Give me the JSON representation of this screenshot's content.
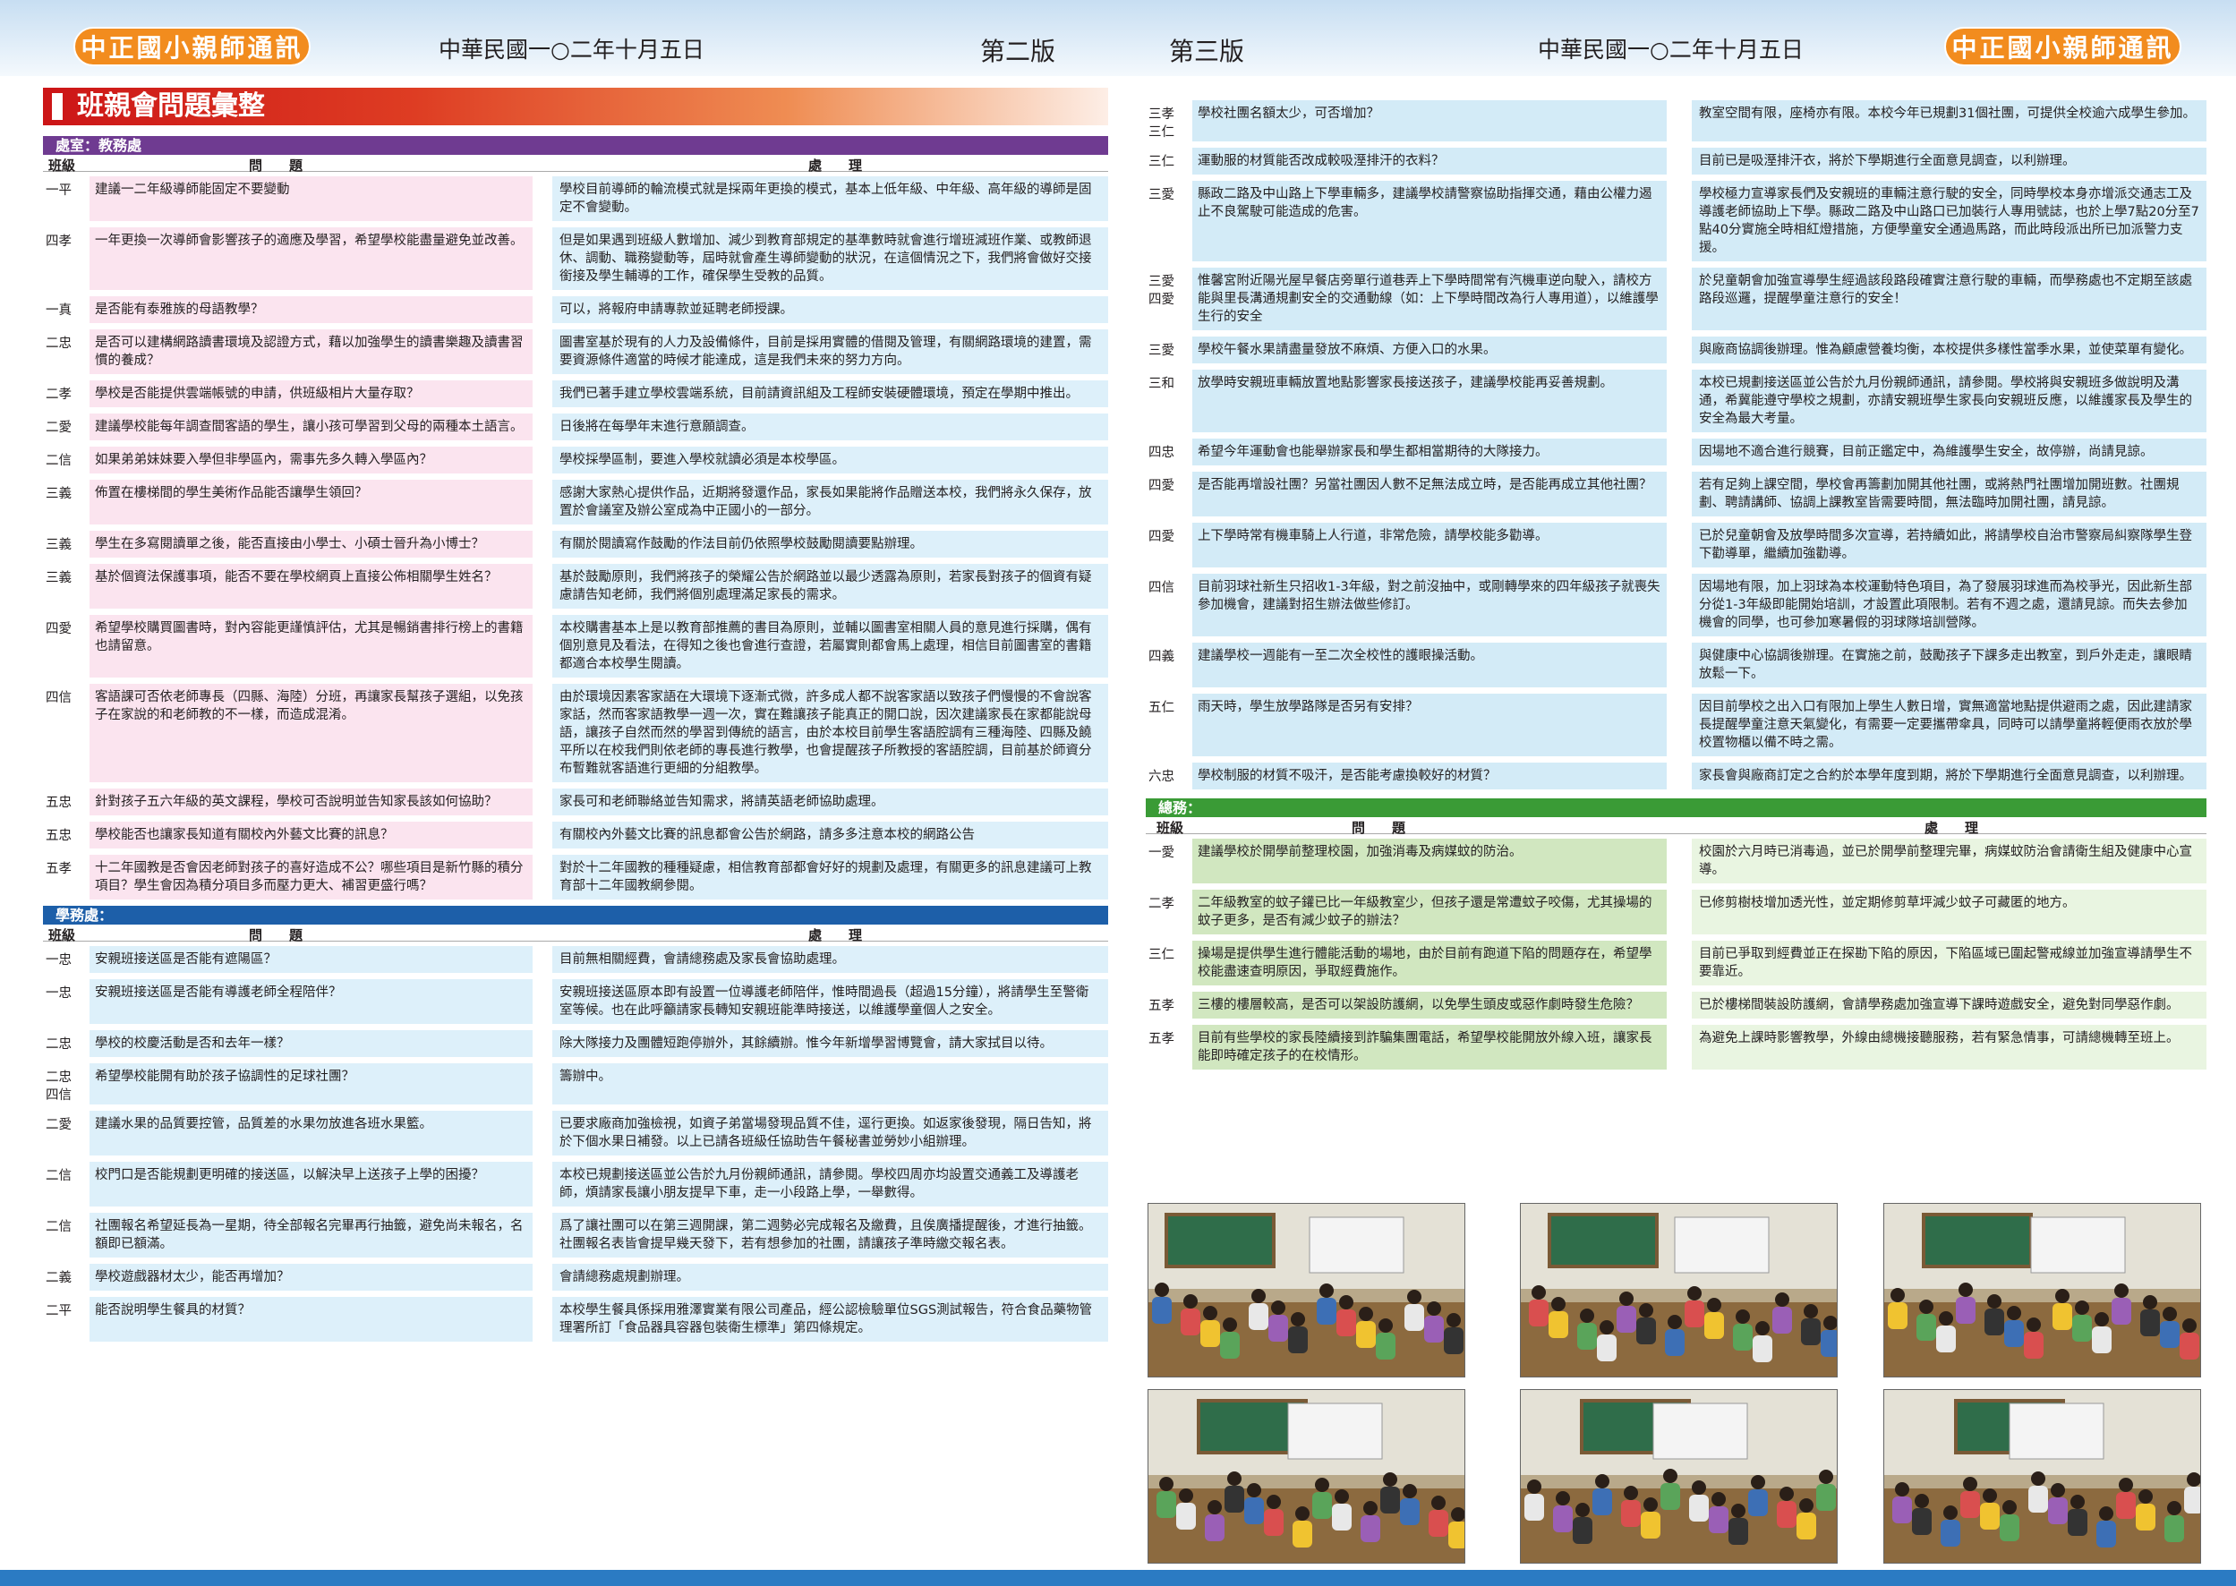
{
  "header": {
    "newsletter_name": "中正國小親師通訊",
    "date": "中華民國一○二年十月五日",
    "left_edition": "第二版",
    "right_edition": "第三版"
  },
  "section_title": "班親會問題彙整",
  "labels": {
    "class": "班級",
    "question": "問　　題",
    "answer": "處　　理"
  },
  "colors": {
    "academic": "#6f3b91",
    "student": "#1d5fa9",
    "general": "#3a9b36",
    "orange": "#f28c1e"
  },
  "academic": {
    "dept": "處室：教務處",
    "rows": [
      {
        "cls": "一平",
        "q": "建議一二年級導師能固定不要變動",
        "a": "學校目前導師的輪流模式就是採兩年更換的模式，基本上低年級、中年級、高年級的導師是固定不會變動。"
      },
      {
        "cls": "四孝",
        "q": "一年更換一次導師會影響孩子的適應及學習，希望學校能盡量避免並改善。",
        "a": "但是如果遇到班級人數增加、減少到教育部規定的基準數時就會進行增班減班作業、或教師退休、調動、職務變動等，屆時就會產生導師變動的狀況，在這個情況之下，我們將會做好交接銜接及學生輔導的工作，確保學生受教的品質。"
      },
      {
        "cls": "一真",
        "q": "是否能有泰雅族的母語教學？",
        "a": "可以，將報府申請專款並延聘老師授課。"
      },
      {
        "cls": "二忠",
        "q": "是否可以建構網路讀書環境及認證方式，藉以加強學生的讀書樂趣及讀書習慣的養成？",
        "a": "圖書室基於現有的人力及設備條件，目前是採用實體的借閱及管理，有關網路環境的建置，需要資源條件適當的時候才能達成，這是我們未來的努力方向。"
      },
      {
        "cls": "二孝",
        "q": "學校是否能提供雲端帳號的申請，供班級相片大量存取？",
        "a": "我們已著手建立學校雲端系統，目前請資訊組及工程師安裝硬體環境，預定在學期中推出。"
      },
      {
        "cls": "二愛",
        "q": "建議學校能每年調查間客語的學生，讓小孩可學習到父母的兩種本土語言。",
        "a": "日後將在每學年末進行意願調查。"
      },
      {
        "cls": "二信",
        "q": "如果弟弟妹妹要入學但非學區內，需事先多久轉入學區內？",
        "a": "學校採學區制，要進入學校就讀必須是本校學區。"
      },
      {
        "cls": "三義",
        "q": "佈置在樓梯間的學生美術作品能否讓學生領回？",
        "a": "感謝大家熱心提供作品，近期將發還作品，家長如果能將作品贈送本校，我們將永久保存，放置於會議室及辦公室成為中正國小的一部分。"
      },
      {
        "cls": "三義",
        "q": "學生在多寫閱讀單之後，能否直接由小學士、小碩士晉升為小博士？",
        "a": "有關於閱讀寫作鼓勵的作法目前仍依照學校鼓勵閱讀要點辦理。"
      },
      {
        "cls": "三義",
        "q": "基於個資法保護事項，能否不要在學校網頁上直接公佈相關學生姓名？",
        "a": "基於鼓勵原則，我們將孩子的榮耀公告於網路並以最少透露為原則，若家長對孩子的個資有疑慮請告知老師，我們將個別處理滿足家長的需求。"
      },
      {
        "cls": "四愛",
        "q": "希望學校購買圖書時，對內容能更謹慎評估，尤其是暢銷書排行榜上的書籍也請留意。",
        "a": "本校購書基本上是以教育部推薦的書目為原則，並輔以圖書室相關人員的意見進行採購，偶有個別意見及看法，在得知之後也會進行查證，若屬實則都會馬上處理，相信目前圖書室的書籍都適合本校學生閱讀。"
      },
      {
        "cls": "四信",
        "q": "客語課可否依老師專長（四縣、海陸）分班，再讓家長幫孩子選組，以免孩子在家說的和老師教的不一樣，而造成混淆。",
        "a": "由於環境因素客家語在大環境下逐漸式微，許多成人都不說客家語以致孩子們慢慢的不會說客家話，然而客家語教學一週一次，實在難讓孩子能真正的開口說，因次建議家長在家都能說母語，讓孩子自然而然的學習到傳統的語言，由於本校目前學生客語腔調有三種海陸、四縣及饒平所以在校我們則依老師的專長進行教學，也會提醒孩子所教授的客語腔調，目前基於師資分布暫難就客語進行更細的分組教學。"
      },
      {
        "cls": "五忠",
        "q": "針對孩子五六年級的英文課程，學校可否說明並告知家長該如何協助？",
        "a": "家長可和老師聯絡並告知需求，將請英語老師協助處理。"
      },
      {
        "cls": "五忠",
        "q": "學校能否也讓家長知道有關校內外藝文比賽的訊息？",
        "a": "有關校內外藝文比賽的訊息都會公告於網路，請多多注意本校的網路公告"
      },
      {
        "cls": "五孝",
        "q": "十二年國教是否會因老師對孩子的喜好造成不公？哪些項目是新竹縣的積分項目？學生會因為積分項目多而壓力更大、補習更盛行嗎？",
        "a": "對於十二年國教的種種疑慮，相信教育部都會好好的規劃及處理，有關更多的訊息建議可上教育部十二年國教網參閱。"
      }
    ]
  },
  "student": {
    "dept": "學務處：",
    "rows": [
      {
        "cls": "一忠",
        "q": "安親班接送區是否能有遮陽區？",
        "a": "目前無相關經費，會請總務處及家長會協助處理。"
      },
      {
        "cls": "一忠",
        "q": "安親班接送區是否能有導護老師全程陪伴？",
        "a": "安親班接送區原本即有設置一位導護老師陪伴，惟時間過長（超過15分鐘），將請學生至警衛室等候。也在此呼籲請家長轉知安親班能準時接送，以維護學童個人之安全。"
      },
      {
        "cls": "二忠",
        "q": "學校的校慶活動是否和去年一樣？",
        "a": "除大隊接力及團體短跑停辦外，其餘續辦。惟今年新增學習博覽會，請大家拭目以待。"
      },
      {
        "cls": "二忠\n四信",
        "q": "希望學校能開有助於孩子協調性的足球社團？",
        "a": "籌辦中。"
      },
      {
        "cls": "二愛",
        "q": "建議水果的品質要控管，品質差的水果勿放進各班水果籃。",
        "a": "已要求廠商加強檢視，如資子弟當場發現品質不佳，逕行更換。如返家後發現，隔日告知，將於下個水果日補發。以上已請各班級任協助告午餐秘書並勞妙小組辦理。"
      },
      {
        "cls": "二信",
        "q": "校門口是否能規劃更明確的接送區，以解決早上送孩子上學的困擾？",
        "a": "本校已規劃接送區並公告於九月份親師通訊，請參閱。學校四周亦均設置交通義工及導護老師，煩請家長讓小朋友提早下車，走一小段路上學，一舉數得。"
      },
      {
        "cls": "二信",
        "q": "社團報名希望延長為一星期，待全部報名完畢再行抽籤，避免尚未報名，名額即已額滿。",
        "a": "爲了讓社團可以在第三週開課，第二週勢必完成報名及繳費，且俟廣播提醒後，才進行抽籤。社團報名表皆會提早幾天發下，若有想參加的社團，請讓孩子準時繳交報名表。"
      },
      {
        "cls": "二義",
        "q": "學校遊戲器材太少，能否再增加？",
        "a": "會請總務處規劃辦理。"
      },
      {
        "cls": "二平",
        "q": "能否說明學生餐具的材質？",
        "a": "本校學生餐具係採用雅澤實業有限公司產品，經公認檢驗單位SGS測試報告，符合食品藥物管理署所訂「食品器具容器包裝衛生標準」第四條規定。"
      }
    ]
  },
  "right_rows": [
    {
      "cls": "三孝\n三仁",
      "q": "學校社團名額太少，可否增加？",
      "a": "教室空間有限，座椅亦有限。本校今年已規劃31個社團，可提供全校逾六成學生參加。"
    },
    {
      "cls": "三仁",
      "q": "運動服的材質能否改成較吸溼排汗的衣料？",
      "a": "目前已是吸溼排汗衣，將於下學期進行全面意見調查，以利辦理。"
    },
    {
      "cls": "三愛",
      "q": "縣政二路及中山路上下學車輛多，建議學校請警察協助指揮交通，藉由公權力遏止不良駕駛可能造成的危害。",
      "a": "學校極力宣導家長們及安親班的車輛注意行駛的安全，同時學校本身亦增派交通志工及導護老師協助上下學。縣政二路及中山路口已加裝行人專用號誌，也於上學7點20分至7點40分實施全時相紅燈措施，方便學童安全通過馬路，而此時段派出所已加派警力支援。"
    },
    {
      "cls": "三愛\n四愛",
      "q": "惟馨宮附近陽光屋早餐店旁單行道巷弄上下學時間常有汽機車逆向駛入，請校方能與里長溝通規劃安全的交通動線（如：上下學時間改為行人專用道），以維護學生行的安全",
      "a": "於兒童朝會加強宣導學生經過該段路段確實注意行駛的車輛，而學務處也不定期至該處路段巡邏，提醒學童注意行的安全！"
    },
    {
      "cls": "三愛",
      "q": "學校午餐水果請盡量發放不麻煩、方便入口的水果。",
      "a": "與廠商協調後辦理。惟為顧慮營養均衡，本校提供多樣性當季水果，並使菜單有變化。"
    },
    {
      "cls": "三和",
      "q": "放學時安親班車輛放置地點影響家長接送孩子，建議學校能再妥善規劃。",
      "a": "本校已規劃接送區並公告於九月份親師通訊，請參閱。學校將與安親班多做說明及溝通，希冀能遵守學校之規劃，亦請安親班學生家長向安親班反應，以維護家長及學生的安全為最大考量。"
    },
    {
      "cls": "四忠",
      "q": "希望今年運動會也能舉辦家長和學生都相當期待的大隊接力。",
      "a": "因場地不適合進行競賽，目前正鑑定中，為維護學生安全，故停辦，尚請見諒。"
    },
    {
      "cls": "四愛",
      "q": "是否能再增設社團？另當社團因人數不足無法成立時，是否能再成立其他社團？",
      "a": "若有足夠上課空間，學校會再籌劃加開其他社團，或將熱門社團增加開班數。社團規劃、聘請講師、協調上課教室皆需要時間，無法臨時加開社團，請見諒。"
    },
    {
      "cls": "四愛",
      "q": "上下學時常有機車騎上人行道，非常危險，請學校能多勸導。",
      "a": "已於兒童朝會及放學時間多次宣導，若持續如此，將請學校自治市警察局糾察隊學生登下勸導單，繼續加強勸導。"
    },
    {
      "cls": "四信",
      "q": "目前羽球社新生只招收1-3年級，對之前沒抽中，或剛轉學來的四年級孩子就喪失參加機會，建議對招生辦法做些修訂。",
      "a": "因場地有限，加上羽球為本校運動特色項目，為了發展羽球進而為校爭光，因此新生部分從1-3年級即能開始培訓，才設置此項限制。若有不週之處，還請見諒。而失去參加機會的同學，也可參加寒暑假的羽球隊培訓營隊。"
    },
    {
      "cls": "四義",
      "q": "建議學校一週能有一至二次全校性的護眼操活動。",
      "a": "與健康中心協調後辦理。在實施之前，鼓勵孩子下課多走出教室，到戶外走走，讓眼睛放鬆一下。"
    },
    {
      "cls": "五仁",
      "q": "雨天時，學生放學路隊是否另有安排？",
      "a": "因目前學校之出入口有限加上學生人數日增，實無適當地點提供避雨之處，因此建請家長提醒學童注意天氣變化，有需要一定要攜帶傘具，同時可以請學童將輕便雨衣放於學校置物櫃以備不時之需。"
    },
    {
      "cls": "六忠",
      "q": "學校制服的材質不吸汗，是否能考慮換較好的材質？",
      "a": "家長會與廠商訂定之合約於本學年度到期，將於下學期進行全面意見調查，以利辦理。"
    }
  ],
  "general": {
    "dept": "總務：",
    "rows": [
      {
        "cls": "一愛",
        "q": "建議學校於開學前整理校園，加強消毒及病媒蚊的防治。",
        "a": "校園於六月時已消毒過，並已於開學前整理完畢，病媒蚊防治會請衛生組及健康中心宣導。"
      },
      {
        "cls": "二孝",
        "q": "二年級教室的蚊子鑵已比一年級教室少，但孩子還是常遭蚊子咬傷，尤其操場的蚊子更多，是否有減少蚊子的辦法？",
        "a": "已修剪樹枝增加透光性，並定期修剪草坪減少蚊子可藏匿的地方。"
      },
      {
        "cls": "三仁",
        "q": "操場是提供學生進行體能活動的場地，由於目前有跑道下陷的問題存在，希望學校能盡速查明原因，爭取經費施作。",
        "a": "目前已爭取到經費並正在探勘下陷的原因，下陷區域已圍起警戒線並加強宣導請學生不要靠近。"
      },
      {
        "cls": "五孝",
        "q": "三樓的樓層較高，是否可以架設防護網，以免學生頭皮或惡作劇時發生危險？",
        "a": "已於樓梯間裝設防護網，會請學務處加強宣導下課時遊戲安全，避免對同學惡作劇。"
      },
      {
        "cls": "五孝",
        "q": "目前有些學校的家長陸續接到詐騙集團電話，希望學校能開放外線入班，讓家長能即時確定孩子的在校情形。",
        "a": "為避免上課時影響教學，外線由總機接聽服務，若有緊急情事，可請總機轉至班上。"
      }
    ]
  },
  "photos": [
    "classroom-photo-1",
    "classroom-photo-2",
    "classroom-photo-3",
    "classroom-photo-4",
    "classroom-photo-5",
    "classroom-photo-6"
  ]
}
